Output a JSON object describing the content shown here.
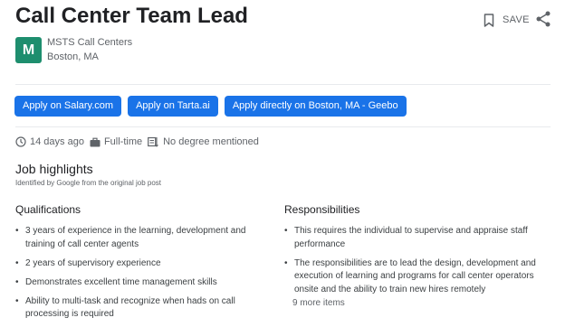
{
  "job": {
    "title": "Call Center Team Lead",
    "save_label": "SAVE",
    "company": "MSTS Call Centers",
    "company_initial": "M",
    "location": "Boston, MA"
  },
  "apply_buttons": [
    {
      "label": "Apply on Salary.com"
    },
    {
      "label": "Apply on Tarta.ai"
    },
    {
      "label": "Apply directly on Boston, MA - Geebo"
    }
  ],
  "meta": {
    "posted": "14 days ago",
    "type": "Full-time",
    "degree": "No degree mentioned"
  },
  "highlights": {
    "title": "Job highlights",
    "subtitle": "Identified by Google from the original job post",
    "qualifications": {
      "heading": "Qualifications",
      "items": [
        "3 years of experience in the learning, development and training of call center agents",
        "2 years of supervisory experience",
        "Demonstrates excellent time management skills",
        "Ability to multi-task and recognize when hads on call processing is required"
      ]
    },
    "responsibilities": {
      "heading": "Responsibilities",
      "items": [
        "This requires the individual to supervise and appraise staff performance",
        "The responsibilities are to lead the design, development and execution of learning and programs for call center operators onsite and the ability to train new hires remotely"
      ],
      "more_label": "9 more items"
    }
  },
  "colors": {
    "accent": "#1a73e8",
    "logo_bg": "#1e8e6e",
    "text_primary": "#202124",
    "text_secondary": "#5f6368"
  }
}
